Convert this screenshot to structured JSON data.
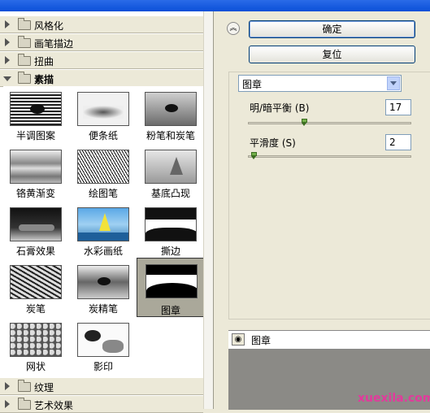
{
  "categories": {
    "before": [
      "风格化",
      "画笔描边",
      "扭曲"
    ],
    "open": "素描",
    "after": [
      "纹理",
      "艺术效果"
    ]
  },
  "filters": [
    "半调图案",
    "便条纸",
    "粉笔和炭笔",
    "铬黄渐变",
    "绘图笔",
    "基底凸现",
    "石膏效果",
    "水彩画纸",
    "撕边",
    "炭笔",
    "炭精笔",
    "图章",
    "网状",
    "影印"
  ],
  "selected_filter": "图章",
  "buttons": {
    "ok": "确定",
    "reset": "复位"
  },
  "collapse_icon": "double-chevron-up-icon",
  "settings": {
    "filter_select": "图章",
    "params": [
      {
        "label": "明/暗平衡 (B)",
        "value": "17",
        "fraction": 0.34
      },
      {
        "label": "平滑度 (S)",
        "value": "2",
        "fraction": 0.02
      }
    ]
  },
  "layer": {
    "name": "图章",
    "visibility_icon": "eye-icon"
  },
  "watermark": "xuexila.com"
}
